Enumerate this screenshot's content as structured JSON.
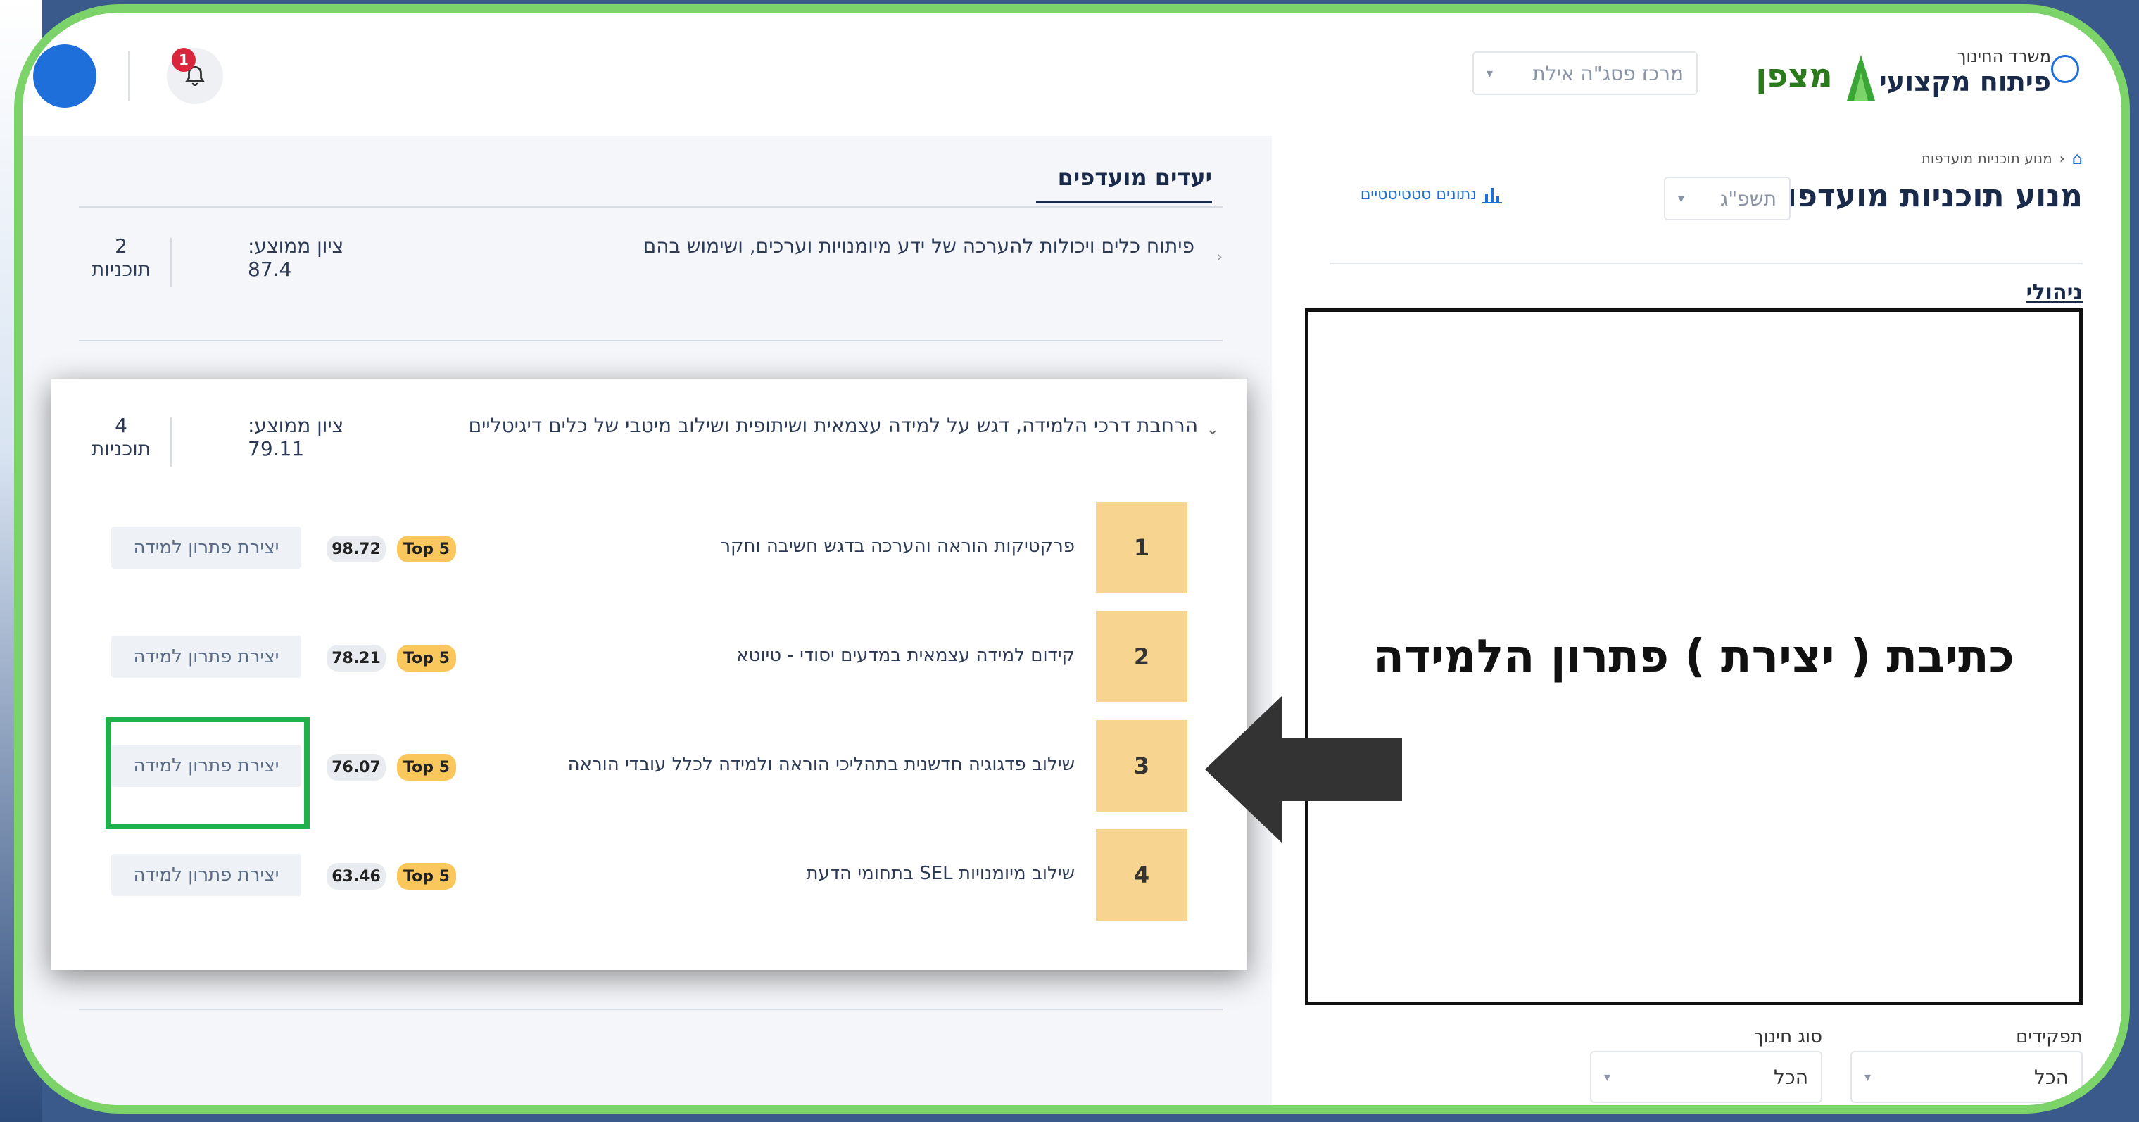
{
  "header": {
    "ministry_small": "משרד החינוך",
    "ministry_big": "פיתוח מקצועי",
    "logo_text": "מצפן",
    "center_dropdown": "מרכז פסג\"ה אילת",
    "notification_count": "1"
  },
  "breadcrumb": {
    "current": "מנוע תוכניות מועדפות"
  },
  "right": {
    "page_title": "מנוע תוכניות מועדפות",
    "year_dropdown": "תשפ\"ג",
    "stats_link": "נתונים סטטיסטיים",
    "section_label": "ניהולי",
    "annotation": "כתיבת ( יצירת ) פתרון הלמידה",
    "filters": [
      {
        "label": "תפקידים",
        "value": "הכל"
      },
      {
        "label": "סוג חינוך",
        "value": "הכל"
      }
    ]
  },
  "left": {
    "tab_label": "יעדים מועדפים",
    "goal1": {
      "text": "פיתוח כלים ויכולות להערכה של ידע מיומנויות וערכים, ושימוש בהם",
      "avg_label": "ציון ממוצע:",
      "avg_value": "87.4",
      "count": "2",
      "count_label": "תוכניות"
    },
    "goal2": {
      "text": "הרחבת דרכי הלמידה, דגש על למידה עצמאית ושיתופית ושילוב מיטבי של כלים דיגיטליים",
      "avg_label": "ציון ממוצע:",
      "avg_value": "79.11",
      "count": "4",
      "count_label": "תוכניות"
    },
    "programs": [
      {
        "rank": "1",
        "name": "פרקטיקות הוראה והערכה בדגש חשיבה וחקר",
        "top": "Top 5",
        "score": "98.72",
        "button": "יצירת פתרון למידה"
      },
      {
        "rank": "2",
        "name": "קידום למידה עצמאית במדעים יסודי - טיוטא",
        "top": "Top 5",
        "score": "78.21",
        "button": "יצירת פתרון למידה"
      },
      {
        "rank": "3",
        "name": "שילוב פדגוגיה חדשנית בתהליכי הוראה ולמידה לכלל עובדי הוראה",
        "top": "Top 5",
        "score": "76.07",
        "button": "יצירת פתרון למידה"
      },
      {
        "rank": "4",
        "name": "שילוב מיומנויות SEL בתחומי הדעת",
        "top": "Top 5",
        "score": "63.46",
        "button": "יצירת פתרון למידה"
      }
    ]
  }
}
